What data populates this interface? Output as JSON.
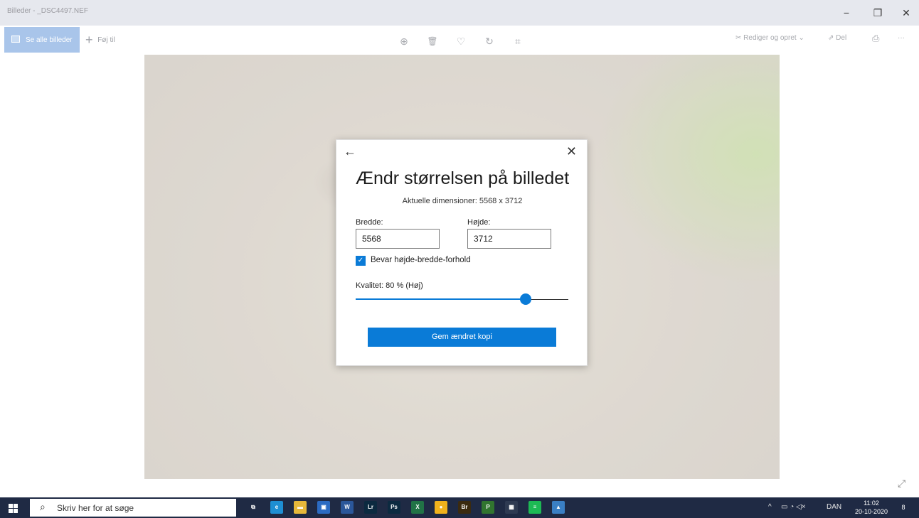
{
  "window": {
    "title": "Billeder - _DSC4497.NEF",
    "minimize_glyph": "−",
    "maximize_glyph": "❐",
    "close_glyph": "✕"
  },
  "toolbar": {
    "see_all_label": "Se alle billeder",
    "add_label": "Føj til",
    "add_glyph": "+",
    "zoom_icon": "⊕",
    "delete_icon": "🗑",
    "favorite_icon": "♡",
    "rotate_icon": "↻",
    "crop_icon": "⌗",
    "edit_label": "Rediger og opret",
    "edit_glyph": "✂",
    "edit_chevron": "⌄",
    "share_label": "Del",
    "share_glyph": "⇗",
    "print_glyph": "⎙",
    "more_glyph": "···"
  },
  "dialog": {
    "back_glyph": "←",
    "close_glyph": "✕",
    "title": "Ændr størrelsen på billedet",
    "current_dimensions": "Aktuelle dimensioner: 5568 x 3712",
    "width_label": "Bredde:",
    "width_value": "5568",
    "height_label": "Højde:",
    "height_value": "3712",
    "keep_ratio_label": "Bevar højde-bredde-forhold",
    "keep_ratio_checked": true,
    "check_glyph": "✓",
    "quality_label": "Kvalitet: 80 % (Høj)",
    "quality_value": 0.8,
    "save_label": "Gem ændret kopi"
  },
  "expand_glyph": "⤢",
  "taskbar": {
    "search_placeholder": "Skriv her for at søge",
    "search_glyph": "⌕",
    "apps": [
      {
        "name": "task-view",
        "label": "⧉",
        "color": "#1f2a44"
      },
      {
        "name": "edge",
        "label": "e",
        "color": "#1e8fd3"
      },
      {
        "name": "file-explorer",
        "label": "▬",
        "color": "#e6b83a"
      },
      {
        "name": "store",
        "label": "▣",
        "color": "#2b6bc2"
      },
      {
        "name": "word",
        "label": "W",
        "color": "#2b579a"
      },
      {
        "name": "lightroom",
        "label": "Lr",
        "color": "#0c2a40"
      },
      {
        "name": "photoshop",
        "label": "Ps",
        "color": "#0c2a40"
      },
      {
        "name": "excel",
        "label": "X",
        "color": "#217346"
      },
      {
        "name": "chrome",
        "label": "●",
        "color": "#f0b21c"
      },
      {
        "name": "bridge",
        "label": "Br",
        "color": "#3a2a10"
      },
      {
        "name": "project",
        "label": "P",
        "color": "#31752f"
      },
      {
        "name": "calculator",
        "label": "▦",
        "color": "#2e3a52"
      },
      {
        "name": "spotify",
        "label": "≡",
        "color": "#1db954"
      },
      {
        "name": "photos",
        "label": "▲",
        "color": "#3a7fc4"
      }
    ],
    "tray_chevron": "^",
    "tray_icons": "▭ ◔ ◁×",
    "language": "DAN",
    "time": "11:02",
    "date": "20-10-2020",
    "notification_count": "8"
  }
}
